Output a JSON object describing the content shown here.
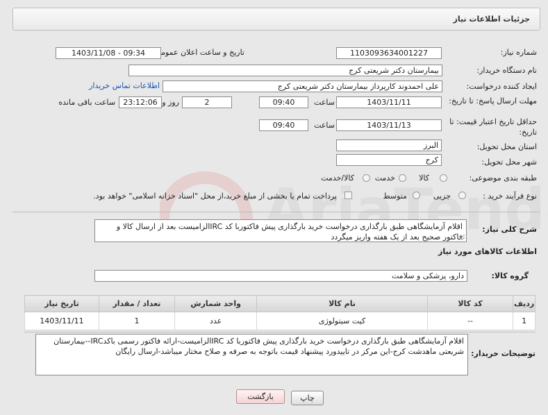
{
  "header": {
    "title": "جزئیات اطلاعات نیاز"
  },
  "fields": {
    "need_number_label": "شماره نیاز:",
    "need_number": "1103093634001227",
    "announce_label": "تاریخ و ساعت اعلان عمومی:",
    "announce_value": "1403/11/08 - 09:34",
    "buyer_org_label": "نام دستگاه خریدار:",
    "buyer_org": "بیمارستان دکتر شریعتی کرج",
    "requester_label": "ایجاد کننده درخواست:",
    "requester": "علی احمدوند کارپرداز بیمارستان دکتر شریعتی کرج",
    "contact_link": "اطلاعات تماس خریدار",
    "deadline_label": "مهلت ارسال پاسخ: تا تاریخ:",
    "deadline_date": "1403/11/11",
    "time_label": "ساعت",
    "deadline_time": "09:40",
    "days_count": "2",
    "days_label": "روز و",
    "remaining_time": "23:12:06",
    "remaining_label": "ساعت باقی مانده",
    "price_validity_label": "حداقل تاریخ اعتبار قیمت: تا تاریخ:",
    "price_validity_date": "1403/11/13",
    "price_validity_time": "09:40",
    "province_label": "استان محل تحویل:",
    "province": "البرز",
    "city_label": "شهر محل تحویل:",
    "city": "کرج",
    "category_label": "طبقه بندی موضوعی:",
    "category_options": [
      "کالا",
      "خدمت",
      "کالا/خدمت"
    ],
    "process_label": "نوع فرآیند خرید :",
    "process_options": [
      "جزیی",
      "متوسط"
    ],
    "payment_note": "پرداخت تمام یا بخشی از مبلغ خرید،از محل \"اسناد خزانه اسلامی\" خواهد بود."
  },
  "description": {
    "label": "شرح کلی نیاز:",
    "text": "اقلام آزمایشگاهی طبق بارگذاری درخواست خرید بارگذاری پیش فاکتوربا کد IRCالزامیست بعد از ارسال کالا و فاکتور صحیح بعد از یک هفته واریز میگردد"
  },
  "goods": {
    "section_title": "اطلاعات کالاهای مورد نیاز",
    "group_label": "گروه کالا:",
    "group_value": "دارو، پزشکی و سلامت",
    "columns": [
      "ردیف",
      "کد کالا",
      "نام کالا",
      "واحد شمارش",
      "تعداد / مقدار",
      "تاریخ نیاز"
    ],
    "rows": [
      [
        "1",
        "--",
        "کیت سیتولوژی",
        "عدد",
        "1",
        "1403/11/11"
      ]
    ]
  },
  "buyer_notes": {
    "label": "توضیحات خریدار:",
    "text": "اقلام آزمایشگاهی طبق بارگذاری درخواست خرید بارگذاری پیش فاکتوربا کد IRCالزامیست-ارائه فاکتور رسمی باکدIRC--بیمارستان شریعتی ماهدشت کرج-این مرکز در تاییدورد پیشنهاد قیمت باتوجه به صرفه و صلاح مختار میباشد-ارسال رایگان"
  },
  "buttons": {
    "print": "چاپ",
    "back": "بازگشت"
  },
  "watermark": "AriaTender.net",
  "colors": {
    "link": "#1a55b8",
    "back_button": "#f4d4d4"
  }
}
